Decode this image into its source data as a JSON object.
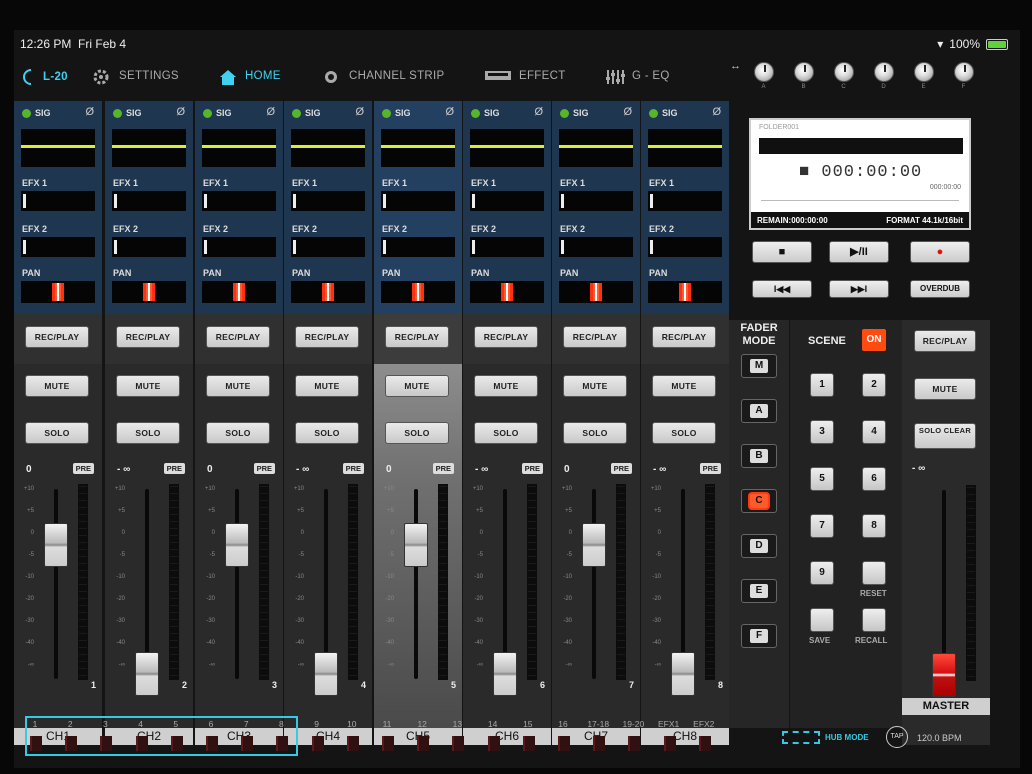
{
  "status": {
    "time": "12:26 PM",
    "date": "Fri Feb 4",
    "battery": "100%"
  },
  "nav": {
    "device": "L-20",
    "items": [
      {
        "label": "SETTINGS",
        "icon": "gear-icon"
      },
      {
        "label": "HOME",
        "icon": "home-icon"
      },
      {
        "label": "CHANNEL STRIP",
        "icon": "channel-strip-icon"
      },
      {
        "label": "EFFECT",
        "icon": "effect-icon"
      },
      {
        "label": "G - EQ",
        "icon": "eq-sliders-icon"
      }
    ],
    "active": "HOME"
  },
  "knobs": [
    "A",
    "B",
    "C",
    "D",
    "E",
    "F"
  ],
  "channels": [
    {
      "name": "CH1",
      "num": "1",
      "level": "0",
      "sig": "SIG",
      "pre": "PRE",
      "efx1": "EFX 1",
      "efx2": "EFX 2",
      "pan": "PAN",
      "rec": "REC/PLAY",
      "mute": "MUTE",
      "solo": "SOLO",
      "fader_db": 0
    },
    {
      "name": "CH2",
      "num": "2",
      "level": "- ∞",
      "sig": "SIG",
      "pre": "PRE",
      "efx1": "EFX 1",
      "efx2": "EFX 2",
      "pan": "PAN",
      "rec": "REC/PLAY",
      "mute": "MUTE",
      "solo": "SOLO",
      "fader_db": "-inf"
    },
    {
      "name": "CH3",
      "num": "3",
      "level": "0",
      "sig": "SIG",
      "pre": "PRE",
      "efx1": "EFX 1",
      "efx2": "EFX 2",
      "pan": "PAN",
      "rec": "REC/PLAY",
      "mute": "MUTE",
      "solo": "SOLO",
      "fader_db": 0
    },
    {
      "name": "CH4",
      "num": "4",
      "level": "- ∞",
      "sig": "SIG",
      "pre": "PRE",
      "efx1": "EFX 1",
      "efx2": "EFX 2",
      "pan": "PAN",
      "rec": "REC/PLAY",
      "mute": "MUTE",
      "solo": "SOLO",
      "fader_db": "-inf"
    },
    {
      "name": "CH5",
      "num": "5",
      "level": "0",
      "sig": "SIG",
      "pre": "PRE",
      "efx1": "EFX 1",
      "efx2": "EFX 2",
      "pan": "PAN",
      "rec": "REC/PLAY",
      "mute": "MUTE",
      "solo": "SOLO",
      "fader_db": 0
    },
    {
      "name": "CH6",
      "num": "6",
      "level": "- ∞",
      "sig": "SIG",
      "pre": "PRE",
      "efx1": "EFX 1",
      "efx2": "EFX 2",
      "pan": "PAN",
      "rec": "REC/PLAY",
      "mute": "MUTE",
      "solo": "SOLO",
      "fader_db": "-inf"
    },
    {
      "name": "CH7",
      "num": "7",
      "level": "0",
      "sig": "SIG",
      "pre": "PRE",
      "efx1": "EFX 1",
      "efx2": "EFX 2",
      "pan": "PAN",
      "rec": "REC/PLAY",
      "mute": "MUTE",
      "solo": "SOLO",
      "fader_db": 0
    },
    {
      "name": "CH8",
      "num": "8",
      "level": "- ∞",
      "sig": "SIG",
      "pre": "PRE",
      "efx1": "EFX 1",
      "efx2": "EFX 2",
      "pan": "PAN",
      "rec": "REC/PLAY",
      "mute": "MUTE",
      "solo": "SOLO",
      "fader_db": "-inf"
    }
  ],
  "scale_labels": [
    "+10",
    "+5",
    "0",
    "-5",
    "-10",
    "-20",
    "-30",
    "-40",
    "-∞"
  ],
  "recorder": {
    "folder": "FOLDER001",
    "timecode": "000:00:00",
    "timecode_small": "000:00:00",
    "remain": "REMAIN:000:00:00",
    "format": "FORMAT 44.1k/16bit"
  },
  "transport": {
    "stop": "■",
    "play_pause": "▶/II",
    "rec": "●",
    "rewind": "I◀◀",
    "forward": "▶▶I",
    "overdub": "OVERDUB"
  },
  "fader_mode": {
    "title_line1": "FADER",
    "title_line2": "MODE",
    "buttons": [
      "M",
      "A",
      "B",
      "C",
      "D",
      "E",
      "F"
    ],
    "active": "C"
  },
  "scene": {
    "title": "SCENE",
    "on": "ON",
    "numbers": [
      "1",
      "2",
      "3",
      "4",
      "5",
      "6",
      "7",
      "8",
      "9"
    ],
    "reset": "RESET",
    "save": "SAVE",
    "recall": "RECALL"
  },
  "master": {
    "name": "MASTER",
    "rec": "REC/PLAY",
    "mute": "MUTE",
    "solo_clear": "SOLO CLEAR",
    "level": "- ∞",
    "fader_db": "-inf"
  },
  "tracks": [
    "1",
    "2",
    "3",
    "4",
    "5",
    "6",
    "7",
    "8",
    "9",
    "10",
    "11",
    "12",
    "13",
    "14",
    "15",
    "16",
    "17-18",
    "19-20",
    "EFX1",
    "EFX2"
  ],
  "footer": {
    "hub_mode": "HUB MODE",
    "tap": "TAP",
    "bpm": "120.0 BPM"
  },
  "colors": {
    "accent": "#36c9e0",
    "active_button": "#ff5a2a",
    "hpf_line": "#d9ef2f",
    "strip_blue": "#1f3650",
    "sig_led": "#57b52c"
  }
}
